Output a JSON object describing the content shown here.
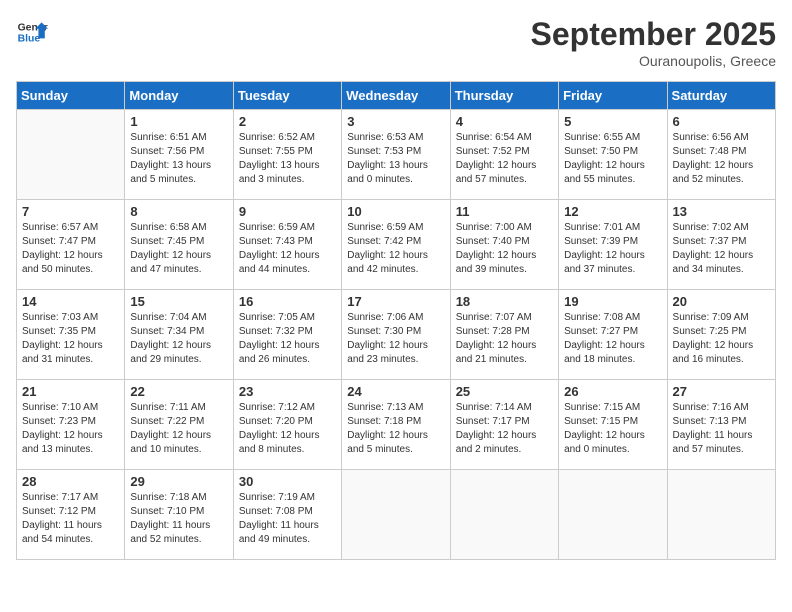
{
  "header": {
    "logo_general": "General",
    "logo_blue": "Blue",
    "month_title": "September 2025",
    "location": "Ouranoupolis, Greece"
  },
  "weekdays": [
    "Sunday",
    "Monday",
    "Tuesday",
    "Wednesday",
    "Thursday",
    "Friday",
    "Saturday"
  ],
  "weeks": [
    [
      {
        "day": "",
        "sunrise": "",
        "sunset": "",
        "daylight": ""
      },
      {
        "day": "1",
        "sunrise": "Sunrise: 6:51 AM",
        "sunset": "Sunset: 7:56 PM",
        "daylight": "Daylight: 13 hours and 5 minutes."
      },
      {
        "day": "2",
        "sunrise": "Sunrise: 6:52 AM",
        "sunset": "Sunset: 7:55 PM",
        "daylight": "Daylight: 13 hours and 3 minutes."
      },
      {
        "day": "3",
        "sunrise": "Sunrise: 6:53 AM",
        "sunset": "Sunset: 7:53 PM",
        "daylight": "Daylight: 13 hours and 0 minutes."
      },
      {
        "day": "4",
        "sunrise": "Sunrise: 6:54 AM",
        "sunset": "Sunset: 7:52 PM",
        "daylight": "Daylight: 12 hours and 57 minutes."
      },
      {
        "day": "5",
        "sunrise": "Sunrise: 6:55 AM",
        "sunset": "Sunset: 7:50 PM",
        "daylight": "Daylight: 12 hours and 55 minutes."
      },
      {
        "day": "6",
        "sunrise": "Sunrise: 6:56 AM",
        "sunset": "Sunset: 7:48 PM",
        "daylight": "Daylight: 12 hours and 52 minutes."
      }
    ],
    [
      {
        "day": "7",
        "sunrise": "Sunrise: 6:57 AM",
        "sunset": "Sunset: 7:47 PM",
        "daylight": "Daylight: 12 hours and 50 minutes."
      },
      {
        "day": "8",
        "sunrise": "Sunrise: 6:58 AM",
        "sunset": "Sunset: 7:45 PM",
        "daylight": "Daylight: 12 hours and 47 minutes."
      },
      {
        "day": "9",
        "sunrise": "Sunrise: 6:59 AM",
        "sunset": "Sunset: 7:43 PM",
        "daylight": "Daylight: 12 hours and 44 minutes."
      },
      {
        "day": "10",
        "sunrise": "Sunrise: 6:59 AM",
        "sunset": "Sunset: 7:42 PM",
        "daylight": "Daylight: 12 hours and 42 minutes."
      },
      {
        "day": "11",
        "sunrise": "Sunrise: 7:00 AM",
        "sunset": "Sunset: 7:40 PM",
        "daylight": "Daylight: 12 hours and 39 minutes."
      },
      {
        "day": "12",
        "sunrise": "Sunrise: 7:01 AM",
        "sunset": "Sunset: 7:39 PM",
        "daylight": "Daylight: 12 hours and 37 minutes."
      },
      {
        "day": "13",
        "sunrise": "Sunrise: 7:02 AM",
        "sunset": "Sunset: 7:37 PM",
        "daylight": "Daylight: 12 hours and 34 minutes."
      }
    ],
    [
      {
        "day": "14",
        "sunrise": "Sunrise: 7:03 AM",
        "sunset": "Sunset: 7:35 PM",
        "daylight": "Daylight: 12 hours and 31 minutes."
      },
      {
        "day": "15",
        "sunrise": "Sunrise: 7:04 AM",
        "sunset": "Sunset: 7:34 PM",
        "daylight": "Daylight: 12 hours and 29 minutes."
      },
      {
        "day": "16",
        "sunrise": "Sunrise: 7:05 AM",
        "sunset": "Sunset: 7:32 PM",
        "daylight": "Daylight: 12 hours and 26 minutes."
      },
      {
        "day": "17",
        "sunrise": "Sunrise: 7:06 AM",
        "sunset": "Sunset: 7:30 PM",
        "daylight": "Daylight: 12 hours and 23 minutes."
      },
      {
        "day": "18",
        "sunrise": "Sunrise: 7:07 AM",
        "sunset": "Sunset: 7:28 PM",
        "daylight": "Daylight: 12 hours and 21 minutes."
      },
      {
        "day": "19",
        "sunrise": "Sunrise: 7:08 AM",
        "sunset": "Sunset: 7:27 PM",
        "daylight": "Daylight: 12 hours and 18 minutes."
      },
      {
        "day": "20",
        "sunrise": "Sunrise: 7:09 AM",
        "sunset": "Sunset: 7:25 PM",
        "daylight": "Daylight: 12 hours and 16 minutes."
      }
    ],
    [
      {
        "day": "21",
        "sunrise": "Sunrise: 7:10 AM",
        "sunset": "Sunset: 7:23 PM",
        "daylight": "Daylight: 12 hours and 13 minutes."
      },
      {
        "day": "22",
        "sunrise": "Sunrise: 7:11 AM",
        "sunset": "Sunset: 7:22 PM",
        "daylight": "Daylight: 12 hours and 10 minutes."
      },
      {
        "day": "23",
        "sunrise": "Sunrise: 7:12 AM",
        "sunset": "Sunset: 7:20 PM",
        "daylight": "Daylight: 12 hours and 8 minutes."
      },
      {
        "day": "24",
        "sunrise": "Sunrise: 7:13 AM",
        "sunset": "Sunset: 7:18 PM",
        "daylight": "Daylight: 12 hours and 5 minutes."
      },
      {
        "day": "25",
        "sunrise": "Sunrise: 7:14 AM",
        "sunset": "Sunset: 7:17 PM",
        "daylight": "Daylight: 12 hours and 2 minutes."
      },
      {
        "day": "26",
        "sunrise": "Sunrise: 7:15 AM",
        "sunset": "Sunset: 7:15 PM",
        "daylight": "Daylight: 12 hours and 0 minutes."
      },
      {
        "day": "27",
        "sunrise": "Sunrise: 7:16 AM",
        "sunset": "Sunset: 7:13 PM",
        "daylight": "Daylight: 11 hours and 57 minutes."
      }
    ],
    [
      {
        "day": "28",
        "sunrise": "Sunrise: 7:17 AM",
        "sunset": "Sunset: 7:12 PM",
        "daylight": "Daylight: 11 hours and 54 minutes."
      },
      {
        "day": "29",
        "sunrise": "Sunrise: 7:18 AM",
        "sunset": "Sunset: 7:10 PM",
        "daylight": "Daylight: 11 hours and 52 minutes."
      },
      {
        "day": "30",
        "sunrise": "Sunrise: 7:19 AM",
        "sunset": "Sunset: 7:08 PM",
        "daylight": "Daylight: 11 hours and 49 minutes."
      },
      {
        "day": "",
        "sunrise": "",
        "sunset": "",
        "daylight": ""
      },
      {
        "day": "",
        "sunrise": "",
        "sunset": "",
        "daylight": ""
      },
      {
        "day": "",
        "sunrise": "",
        "sunset": "",
        "daylight": ""
      },
      {
        "day": "",
        "sunrise": "",
        "sunset": "",
        "daylight": ""
      }
    ]
  ]
}
